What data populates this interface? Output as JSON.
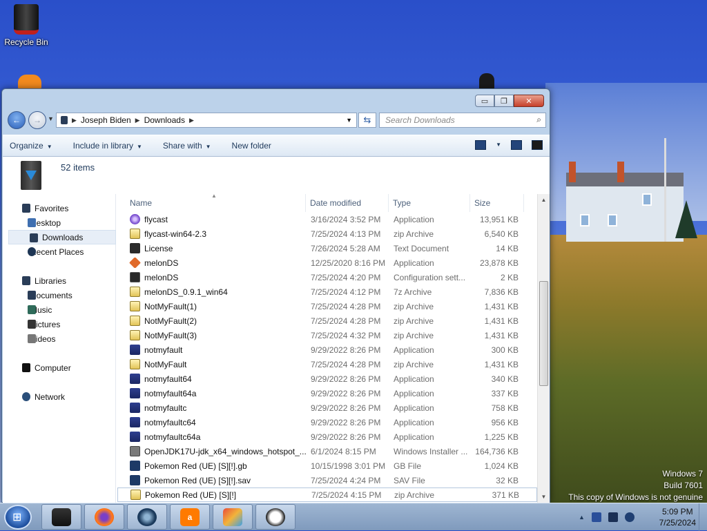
{
  "desktop": {
    "recycle_bin_label": "Recycle Bin",
    "watermark": {
      "line1": "Windows 7",
      "line2": "Build 7601",
      "line3": "This copy of Windows is not genuine"
    }
  },
  "window": {
    "caption": {
      "minimize": "▭",
      "maximize": "❐",
      "close": "✕"
    },
    "address": {
      "segments": [
        "Joseph Biden",
        "Downloads"
      ]
    },
    "search_placeholder": "Search Downloads",
    "toolbar": {
      "organize": "Organize",
      "include_in_library": "Include in library",
      "share_with": "Share with",
      "new_folder": "New folder"
    },
    "details": {
      "items_count": "52 items"
    },
    "nav_pane": {
      "favorites": "Favorites",
      "desktop": "Desktop",
      "downloads": "Downloads",
      "recent_places": "Recent Places",
      "libraries": "Libraries",
      "documents": "Documents",
      "music": "Music",
      "pictures": "Pictures",
      "videos": "Videos",
      "computer": "Computer",
      "network": "Network"
    },
    "columns": {
      "name": "Name",
      "date_modified": "Date modified",
      "type": "Type",
      "size": "Size"
    },
    "files": [
      {
        "name": "flycast",
        "date": "3/16/2024 3:52 PM",
        "type": "Application",
        "size": "13,951 KB",
        "icon": "flycast-icon"
      },
      {
        "name": "flycast-win64-2.3",
        "date": "7/25/2024 4:13 PM",
        "type": "zip Archive",
        "size": "6,540 KB",
        "icon": "zip-icon"
      },
      {
        "name": "License",
        "date": "7/26/2024 5:28 AM",
        "type": "Text Document",
        "size": "14 KB",
        "icon": "text-document-icon"
      },
      {
        "name": "melonDS",
        "date": "12/25/2020 8:16 PM",
        "type": "Application",
        "size": "23,878 KB",
        "icon": "melonds-icon"
      },
      {
        "name": "melonDS",
        "date": "7/25/2024 4:20 PM",
        "type": "Configuration sett...",
        "size": "2 KB",
        "icon": "config-icon"
      },
      {
        "name": "melonDS_0.9.1_win64",
        "date": "7/25/2024 4:12 PM",
        "type": "7z Archive",
        "size": "7,836 KB",
        "icon": "zip-icon"
      },
      {
        "name": "NotMyFault(1)",
        "date": "7/25/2024 4:28 PM",
        "type": "zip Archive",
        "size": "1,431 KB",
        "icon": "zip-icon"
      },
      {
        "name": "NotMyFault(2)",
        "date": "7/25/2024 4:28 PM",
        "type": "zip Archive",
        "size": "1,431 KB",
        "icon": "zip-icon"
      },
      {
        "name": "NotMyFault(3)",
        "date": "7/25/2024 4:32 PM",
        "type": "zip Archive",
        "size": "1,431 KB",
        "icon": "zip-icon"
      },
      {
        "name": "notmyfault",
        "date": "9/29/2022 8:26 PM",
        "type": "Application",
        "size": "300 KB",
        "icon": "app-icon"
      },
      {
        "name": "NotMyFault",
        "date": "7/25/2024 4:28 PM",
        "type": "zip Archive",
        "size": "1,431 KB",
        "icon": "zip-icon"
      },
      {
        "name": "notmyfault64",
        "date": "9/29/2022 8:26 PM",
        "type": "Application",
        "size": "340 KB",
        "icon": "app-icon"
      },
      {
        "name": "notmyfault64a",
        "date": "9/29/2022 8:26 PM",
        "type": "Application",
        "size": "337 KB",
        "icon": "app-icon"
      },
      {
        "name": "notmyfaultc",
        "date": "9/29/2022 8:26 PM",
        "type": "Application",
        "size": "758 KB",
        "icon": "app-icon"
      },
      {
        "name": "notmyfaultc64",
        "date": "9/29/2022 8:26 PM",
        "type": "Application",
        "size": "956 KB",
        "icon": "app-icon"
      },
      {
        "name": "notmyfaultc64a",
        "date": "9/29/2022 8:26 PM",
        "type": "Application",
        "size": "1,225 KB",
        "icon": "app-icon"
      },
      {
        "name": "OpenJDK17U-jdk_x64_windows_hotspot_...",
        "date": "6/1/2024 8:15 PM",
        "type": "Windows Installer ...",
        "size": "164,736 KB",
        "icon": "installer-icon"
      },
      {
        "name": "Pokemon Red (UE) [S][!].gb",
        "date": "10/15/1998 3:01 PM",
        "type": "GB File",
        "size": "1,024 KB",
        "icon": "gb-file-icon"
      },
      {
        "name": "Pokemon Red (UE) [S][!].sav",
        "date": "7/25/2024 4:24 PM",
        "type": "SAV File",
        "size": "32 KB",
        "icon": "gb-file-icon"
      },
      {
        "name": "Pokemon Red (UE) [S][!]",
        "date": "7/25/2024 4:15 PM",
        "type": "zip Archive",
        "size": "371 KB",
        "icon": "zip-icon"
      }
    ]
  },
  "taskbar": {
    "apps": [
      "explorer-icon",
      "firefox-icon",
      "steam-icon",
      "avast-icon",
      "game-icon",
      "panda-icon"
    ],
    "clock_time": "5:09 PM",
    "clock_date": "7/25/2024",
    "tray_overflow": "▲"
  }
}
